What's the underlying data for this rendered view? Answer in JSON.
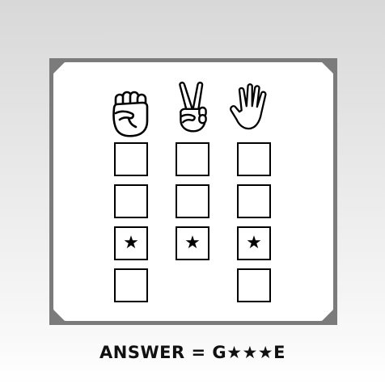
{
  "puzzle": {
    "columns": [
      {
        "hand_icon": "rock-fist-icon",
        "cells": [
          "",
          "",
          "★",
          ""
        ]
      },
      {
        "hand_icon": "scissors-peace-icon",
        "cells": [
          "",
          "",
          "★"
        ]
      },
      {
        "hand_icon": "paper-open-hand-icon",
        "cells": [
          "",
          "",
          "★",
          ""
        ]
      }
    ]
  },
  "answer": {
    "label": "ANSWER",
    "equals": "=",
    "value": "G★★★E"
  },
  "colors": {
    "frame": "#7b7b7b",
    "card": "#ffffff",
    "ink": "#000000"
  }
}
